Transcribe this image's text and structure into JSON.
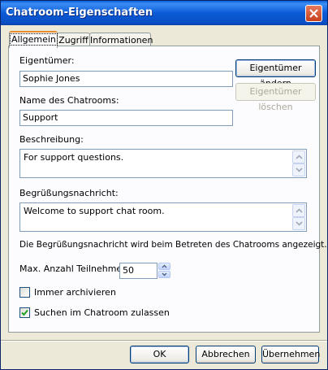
{
  "window": {
    "title": "Chatroom-Eigenschaften"
  },
  "tabs": [
    {
      "label": "Allgemein",
      "selected": true
    },
    {
      "label": "Zugriff",
      "selected": false
    },
    {
      "label": "Informationen",
      "selected": false
    }
  ],
  "owner": {
    "label": "Eigentümer:",
    "value": "Sophie Jones",
    "change_button": "Eigentümer ändern",
    "delete_button": "Eigentümer löschen"
  },
  "room_name": {
    "label": "Name des Chatrooms:",
    "value": "Support"
  },
  "description": {
    "label": "Beschreibung:",
    "value": "For support questions."
  },
  "welcome": {
    "label": "Begrüßungsnachricht:",
    "value": "Welcome to support chat room.",
    "hint": "Die Begrüßungsnachricht wird beim Betreten des Chatrooms angezeigt."
  },
  "max_participants": {
    "label": "Max. Anzahl Teilnehmer:",
    "value": "50"
  },
  "archive": {
    "label": "Immer archivieren",
    "checked": false
  },
  "search": {
    "label": "Suchen im Chatroom zulassen",
    "checked": true
  },
  "buttons": {
    "ok": "OK",
    "cancel": "Abbrechen",
    "apply": "Übernehmen"
  }
}
